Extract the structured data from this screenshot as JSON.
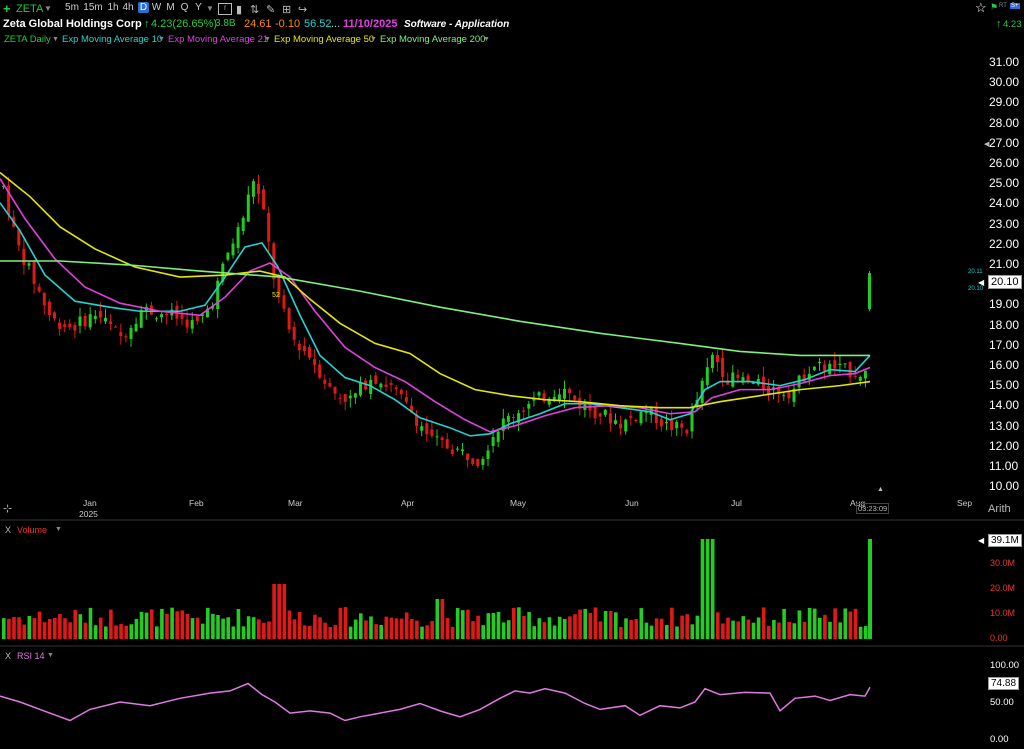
{
  "header": {
    "symbol": "ZETA",
    "company": "Zeta Global Holdings Corp",
    "change": "4.23(26.65%)",
    "market_cap": "3.8B",
    "price_a": "24.61",
    "price_change": "-0.10",
    "rsi_value": "56.52",
    "ellipsis": "...",
    "date": "11/10/2025",
    "sector": "Software - Application",
    "right_change": "4.23",
    "rt_badge": "RT",
    "s_badge": "S+"
  },
  "timeframes": [
    "5m",
    "15m",
    "1h",
    "4h",
    "D",
    "W",
    "M",
    "Q",
    "Y"
  ],
  "active_timeframe": "D",
  "indicators": [
    {
      "label": "ZETA Daily",
      "color": "#28c840"
    },
    {
      "label": "Exp Moving Average 10",
      "color": "#22d3d3"
    },
    {
      "label": "Exp Moving Average 21",
      "color": "#e040e0"
    },
    {
      "label": "Exp Moving Average 50",
      "color": "#e6e600"
    },
    {
      "label": "Exp Moving Average 200",
      "color": "#7ef07e"
    }
  ],
  "price_axis": [
    "31.00",
    "30.00",
    "29.00",
    "28.00",
    "27.00",
    "26.00",
    "25.00",
    "24.00",
    "23.00",
    "22.00",
    "21.00",
    "20.00",
    "19.00",
    "18.00",
    "17.00",
    "16.00",
    "15.00",
    "14.00",
    "13.00",
    "12.00",
    "11.00",
    "10.00"
  ],
  "current_price": "20.10",
  "price_tags": [
    "20.11",
    "20.10"
  ],
  "ema_tag": "52",
  "months": [
    "Jan",
    "Feb",
    "Mar",
    "Apr",
    "May",
    "Jun",
    "Jul",
    "Aug",
    "Sep"
  ],
  "year": "2025",
  "scale_mode": "Arith",
  "clock": "03:23:09",
  "volume": {
    "title": "Volume",
    "current": "39.1M",
    "axis": [
      "30.0M",
      "20.0M",
      "10.0M",
      "0.00"
    ]
  },
  "rsi": {
    "title": "RSI 14",
    "current": "74.88",
    "axis": [
      "100.00",
      "50.00",
      "0.00"
    ]
  },
  "colors": {
    "up": "#22cc22",
    "down": "#e01818",
    "ema10": "#22d3d3",
    "ema21": "#e040e0",
    "ema50": "#e6e600",
    "ema200": "#7ef07e",
    "rsi": "#e07ae0"
  }
}
